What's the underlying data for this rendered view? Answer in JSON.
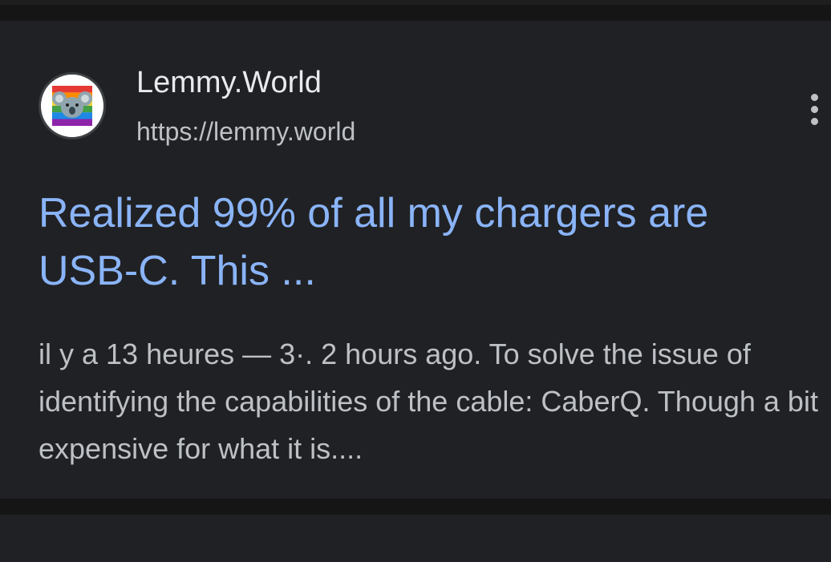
{
  "result": {
    "site_name": "Lemmy.World",
    "site_url": "https://lemmy.world",
    "favicon_icon": "koala-rainbow-logo-icon",
    "more_icon": "more-vertical-icon",
    "title": "Realized 99% of all my chargers are USB-C. This ...",
    "snippet": "il y a 13 heures — 3·. 2 hours ago. To solve the issue of identifying the capabilities of the cable: CaberQ. Though a bit expensive for what it is...."
  },
  "colors": {
    "background": "#202124",
    "divider": "#151515",
    "title_link": "#8ab4f8",
    "primary_text": "#e8eaed",
    "secondary_text": "#bdc1c6"
  }
}
